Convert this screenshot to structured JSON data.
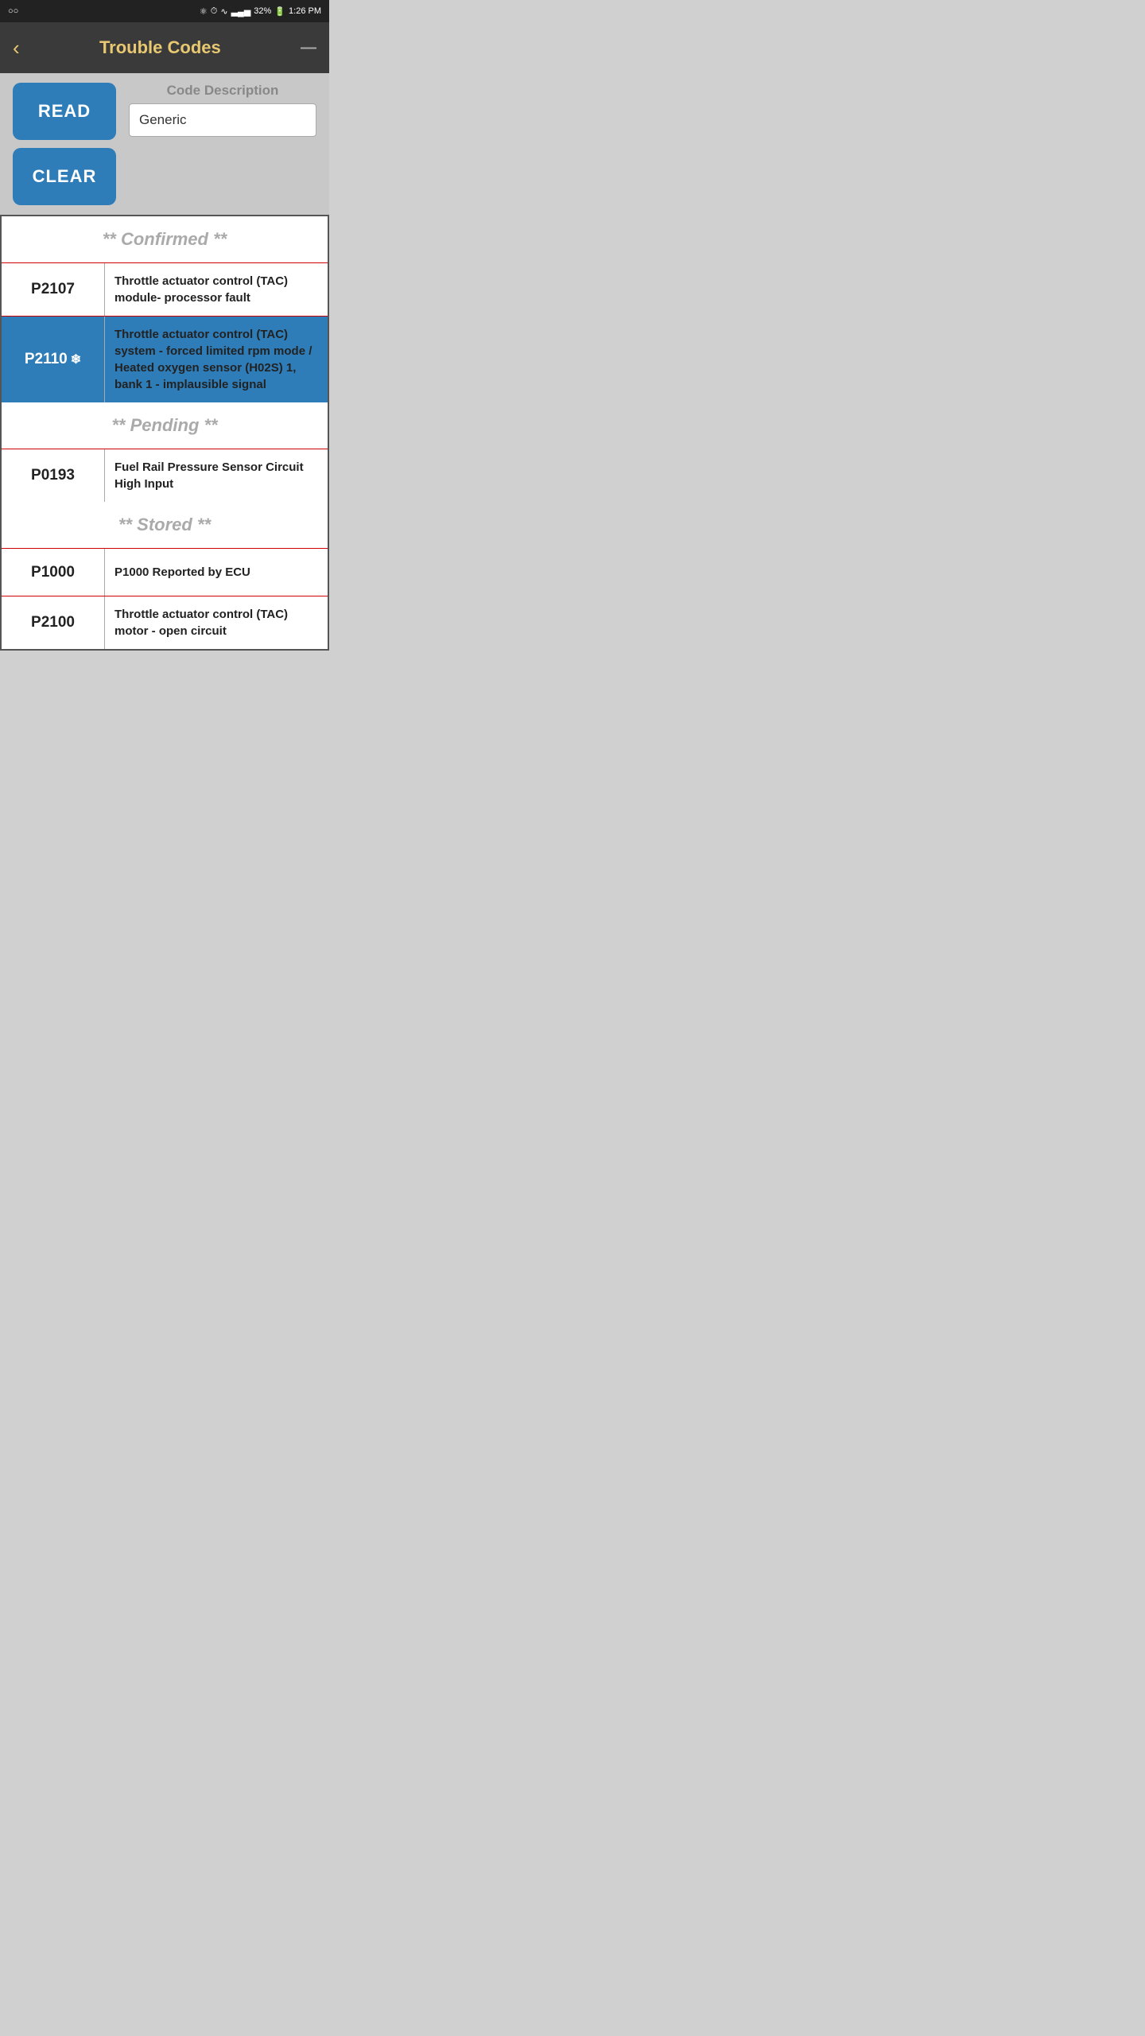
{
  "statusBar": {
    "leftIcon": "○○",
    "bluetooth": "⚙",
    "alarm": "⏰",
    "wifi": "wifi",
    "signal": "signal",
    "battery": "32%",
    "time": "1:26 PM"
  },
  "header": {
    "backLabel": "‹",
    "title": "Trouble Codes",
    "menuLabel": "—"
  },
  "controls": {
    "readLabel": "READ",
    "clearLabel": "CLEAR",
    "codeDescriptionLabel": "Code Description",
    "codeDescriptionValue": "Generic"
  },
  "sections": [
    {
      "title": "** Confirmed **",
      "codes": [
        {
          "code": "P2107",
          "description": "Throttle actuator control (TAC) module- processor fault",
          "highlighted": false,
          "snowflake": false
        },
        {
          "code": "P2110",
          "description": "Throttle actuator control (TAC) system - forced limited rpm mode / Heated oxygen sensor (H02S) 1, bank 1 - implausible signal",
          "highlighted": true,
          "snowflake": true
        }
      ]
    },
    {
      "title": "** Pending **",
      "codes": [
        {
          "code": "P0193",
          "description": "Fuel Rail Pressure Sensor Circuit High Input",
          "highlighted": false,
          "snowflake": false
        }
      ]
    },
    {
      "title": "** Stored **",
      "codes": [
        {
          "code": "P1000",
          "description": "P1000 Reported by ECU",
          "highlighted": false,
          "snowflake": false
        },
        {
          "code": "P2100",
          "description": "Throttle actuator control (TAC) motor - open circuit",
          "highlighted": false,
          "snowflake": false
        }
      ]
    }
  ]
}
